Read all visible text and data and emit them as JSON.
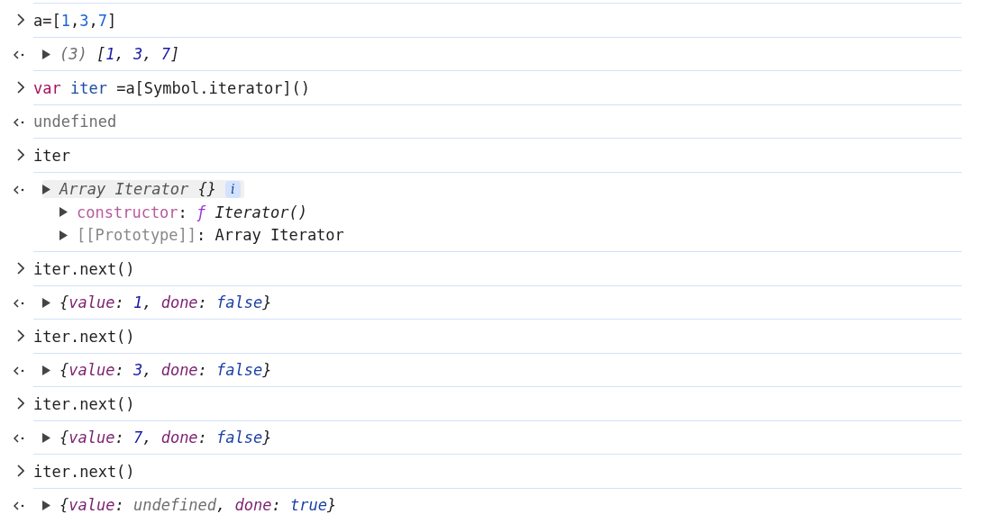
{
  "entries": [
    {
      "kind": "input",
      "tokens": [
        {
          "text": "a=[",
          "kind": "plain"
        },
        {
          "text": "1",
          "kind": "number"
        },
        {
          "text": ",",
          "kind": "plain"
        },
        {
          "text": "3",
          "kind": "number"
        },
        {
          "text": ",",
          "kind": "plain"
        },
        {
          "text": "7",
          "kind": "number"
        },
        {
          "text": "]",
          "kind": "plain"
        }
      ]
    },
    {
      "kind": "object",
      "highlighted": false,
      "tokens": [
        {
          "text": "(3) ",
          "kind": "dim"
        },
        {
          "text": "[",
          "kind": "plain"
        },
        {
          "text": "1",
          "kind": "number"
        },
        {
          "text": ", ",
          "kind": "plain"
        },
        {
          "text": "3",
          "kind": "number"
        },
        {
          "text": ", ",
          "kind": "plain"
        },
        {
          "text": "7",
          "kind": "number"
        },
        {
          "text": "]",
          "kind": "plain"
        }
      ]
    },
    {
      "kind": "input",
      "tokens": [
        {
          "text": "var ",
          "kind": "keyword"
        },
        {
          "text": "iter",
          "kind": "variable"
        },
        {
          "text": " =a[Symbol.iterator]()",
          "kind": "plain"
        }
      ]
    },
    {
      "kind": "result",
      "tokens": [
        {
          "text": "undefined",
          "kind": "dim"
        }
      ]
    },
    {
      "kind": "input",
      "tokens": [
        {
          "text": "iter",
          "kind": "plain"
        }
      ]
    },
    {
      "kind": "object",
      "highlighted": true,
      "badge": "i",
      "tokens": [
        {
          "text": "Array Iterator ",
          "kind": "classname"
        },
        {
          "text": "{}",
          "kind": "plain"
        }
      ],
      "children": [
        {
          "tokens": [
            {
              "text": "constructor",
              "kind": "property"
            },
            {
              "text": ": ",
              "kind": "plain"
            },
            {
              "text": "ƒ ",
              "kind": "function"
            },
            {
              "text": "Iterator()",
              "kind": "italic"
            }
          ]
        },
        {
          "tokens": [
            {
              "text": "[[Prototype]]",
              "kind": "internal"
            },
            {
              "text": ": Array Iterator",
              "kind": "plain"
            }
          ]
        }
      ]
    },
    {
      "kind": "input",
      "tokens": [
        {
          "text": "iter.next()",
          "kind": "plain"
        }
      ]
    },
    {
      "kind": "object",
      "highlighted": false,
      "tokens": [
        {
          "text": "{",
          "kind": "plain"
        },
        {
          "text": "value",
          "kind": "key"
        },
        {
          "text": ": ",
          "kind": "plain"
        },
        {
          "text": "1",
          "kind": "number"
        },
        {
          "text": ", ",
          "kind": "plain"
        },
        {
          "text": "done",
          "kind": "key"
        },
        {
          "text": ": ",
          "kind": "plain"
        },
        {
          "text": "false",
          "kind": "bool"
        },
        {
          "text": "}",
          "kind": "plain"
        }
      ]
    },
    {
      "kind": "input",
      "tokens": [
        {
          "text": "iter.next()",
          "kind": "plain"
        }
      ]
    },
    {
      "kind": "object",
      "highlighted": false,
      "tokens": [
        {
          "text": "{",
          "kind": "plain"
        },
        {
          "text": "value",
          "kind": "key"
        },
        {
          "text": ": ",
          "kind": "plain"
        },
        {
          "text": "3",
          "kind": "number"
        },
        {
          "text": ", ",
          "kind": "plain"
        },
        {
          "text": "done",
          "kind": "key"
        },
        {
          "text": ": ",
          "kind": "plain"
        },
        {
          "text": "false",
          "kind": "bool"
        },
        {
          "text": "}",
          "kind": "plain"
        }
      ]
    },
    {
      "kind": "input",
      "tokens": [
        {
          "text": "iter.next()",
          "kind": "plain"
        }
      ]
    },
    {
      "kind": "object",
      "highlighted": false,
      "tokens": [
        {
          "text": "{",
          "kind": "plain"
        },
        {
          "text": "value",
          "kind": "key"
        },
        {
          "text": ": ",
          "kind": "plain"
        },
        {
          "text": "7",
          "kind": "number"
        },
        {
          "text": ", ",
          "kind": "plain"
        },
        {
          "text": "done",
          "kind": "key"
        },
        {
          "text": ": ",
          "kind": "plain"
        },
        {
          "text": "false",
          "kind": "bool"
        },
        {
          "text": "}",
          "kind": "plain"
        }
      ]
    },
    {
      "kind": "input",
      "tokens": [
        {
          "text": "iter.next()",
          "kind": "plain"
        }
      ]
    },
    {
      "kind": "object",
      "highlighted": false,
      "tokens": [
        {
          "text": "{",
          "kind": "plain"
        },
        {
          "text": "value",
          "kind": "key"
        },
        {
          "text": ": ",
          "kind": "plain"
        },
        {
          "text": "undefined",
          "kind": "dim"
        },
        {
          "text": ", ",
          "kind": "plain"
        },
        {
          "text": "done",
          "kind": "key"
        },
        {
          "text": ": ",
          "kind": "plain"
        },
        {
          "text": "true",
          "kind": "bool"
        },
        {
          "text": "}",
          "kind": "plain"
        }
      ]
    }
  ]
}
